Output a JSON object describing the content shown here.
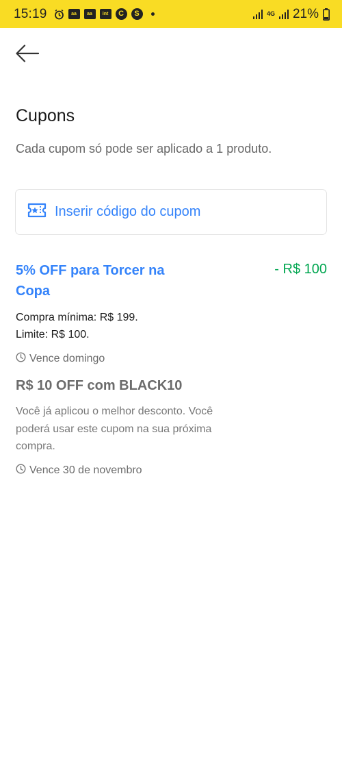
{
  "status_bar": {
    "time": "15:19",
    "network_type": "4G",
    "battery": "21%",
    "notification_icons": [
      "alarm-icon",
      "app-badge-icon",
      "app-badge-icon",
      "inter-icon",
      "browser-icon",
      "s-icon"
    ]
  },
  "header": {
    "back_icon": "back-arrow-icon",
    "title": "Cupons",
    "subtitle": "Cada cupom só pode ser aplicado a 1 produto."
  },
  "coupon_input": {
    "icon": "ticket-star-icon",
    "label": "Inserir código do cupom"
  },
  "coupons": [
    {
      "title": "5% OFF para Torcer na Copa",
      "discount": "- R$ 100",
      "lines": [
        "Compra mínima: R$ 199.",
        "Limite: R$ 100."
      ],
      "expiry": "Vence domingo"
    },
    {
      "title": "R$ 10 OFF com BLACK10",
      "note": "Você já aplicou o melhor desconto. Você poderá usar este cupom na sua próxima compra.",
      "expiry": "Vence 30 de novembro"
    }
  ],
  "colors": {
    "status_bar": "#f9dc24",
    "accent": "#3483fa",
    "discount": "#00a650",
    "muted": "#6b6b6b"
  }
}
